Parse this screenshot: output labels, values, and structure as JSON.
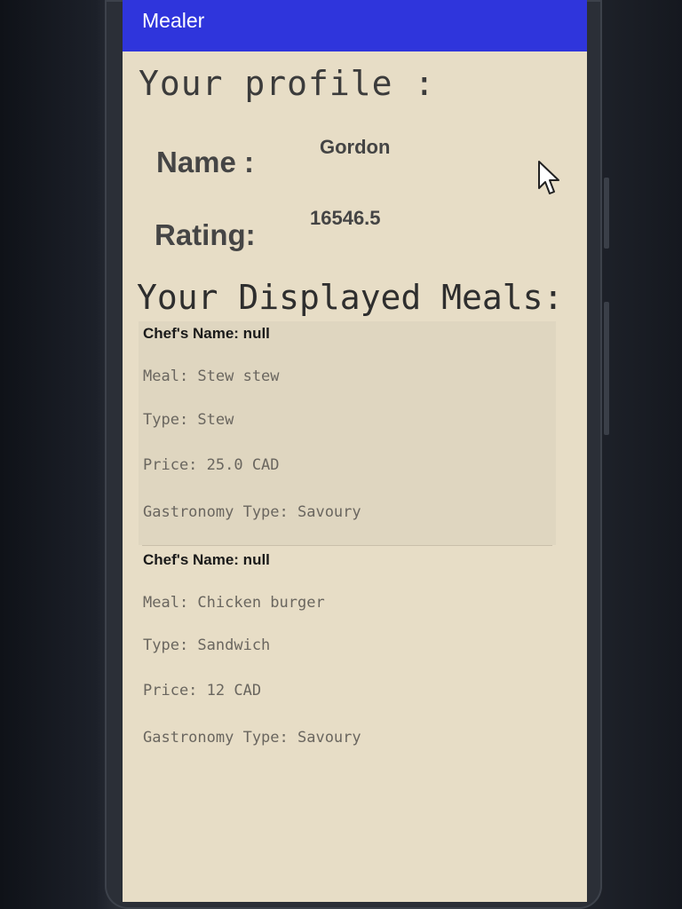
{
  "app": {
    "title": "Mealer"
  },
  "profile": {
    "heading": "Your profile :",
    "name_label": "Name :",
    "name_value": "Gordon",
    "rating_label": "Rating:",
    "rating_value": "16546.5"
  },
  "meals": {
    "heading": "Your Displayed Meals:",
    "items": [
      {
        "chef": "Chef's Name: null",
        "meal": "Meal: Stew stew",
        "type": "Type: Stew",
        "price": "Price: 25.0 CAD",
        "gastronomy": "Gastronomy Type: Savoury"
      },
      {
        "chef": "Chef's Name: null",
        "meal": "Meal: Chicken burger",
        "type": "Type: Sandwich",
        "price": "Price: 12 CAD",
        "gastronomy": "Gastronomy Type: Savoury"
      }
    ]
  },
  "colors": {
    "app_bar": "#2f35dc",
    "screen_background": "#e7ddc6"
  },
  "icons": {
    "cursor": "mouse-pointer-icon"
  }
}
